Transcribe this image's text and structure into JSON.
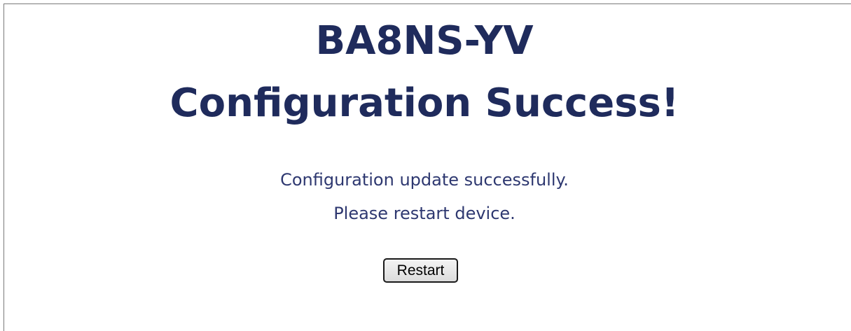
{
  "header": {
    "device_name": "BA8NS-YV",
    "title": "Configuration Success!"
  },
  "message": {
    "line1": "Configuration update successfully.",
    "line2": "Please restart device."
  },
  "actions": {
    "restart_label": "Restart"
  },
  "colors": {
    "heading": "#1f2b5c",
    "text": "#2e3870"
  }
}
